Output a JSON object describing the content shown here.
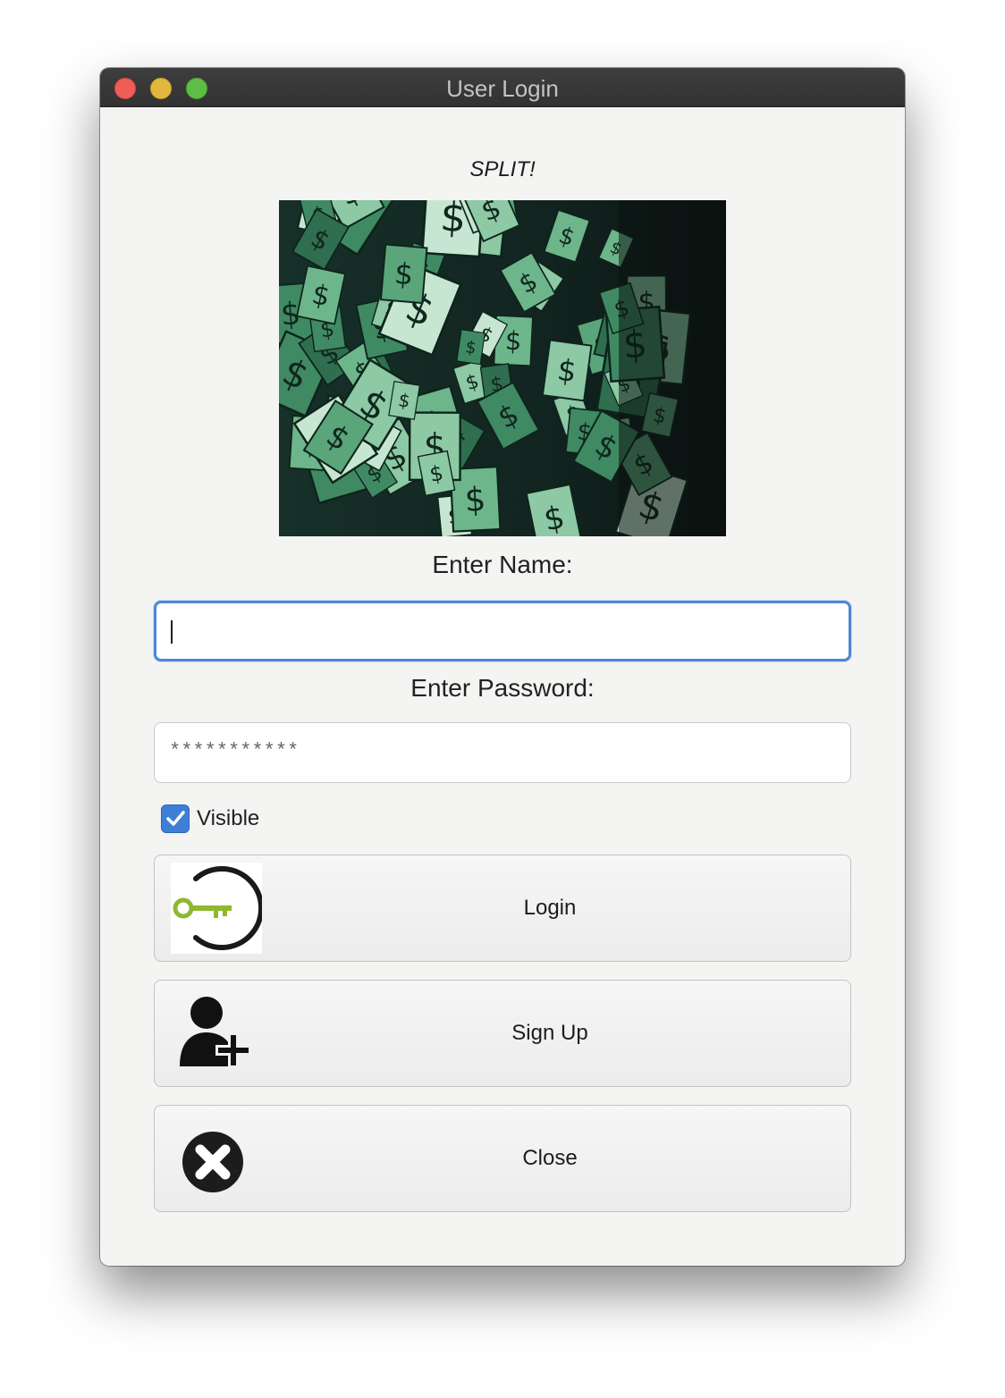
{
  "window": {
    "title": "User Login"
  },
  "app": {
    "heading": "SPLIT!",
    "banner_icon": "falling-money-image"
  },
  "form": {
    "name_label": "Enter Name:",
    "name_value": "",
    "password_label": "Enter Password:",
    "password_value": "***********",
    "visible_label": "Visible",
    "visible_checked": true
  },
  "buttons": {
    "login_label": "Login",
    "login_icon": "key-power-icon",
    "signup_label": "Sign Up",
    "signup_icon": "add-user-icon",
    "close_label": "Close",
    "close_icon": "close-circle-icon"
  },
  "colors": {
    "accent": "#4f86d6",
    "key_green": "#8fb82f"
  }
}
